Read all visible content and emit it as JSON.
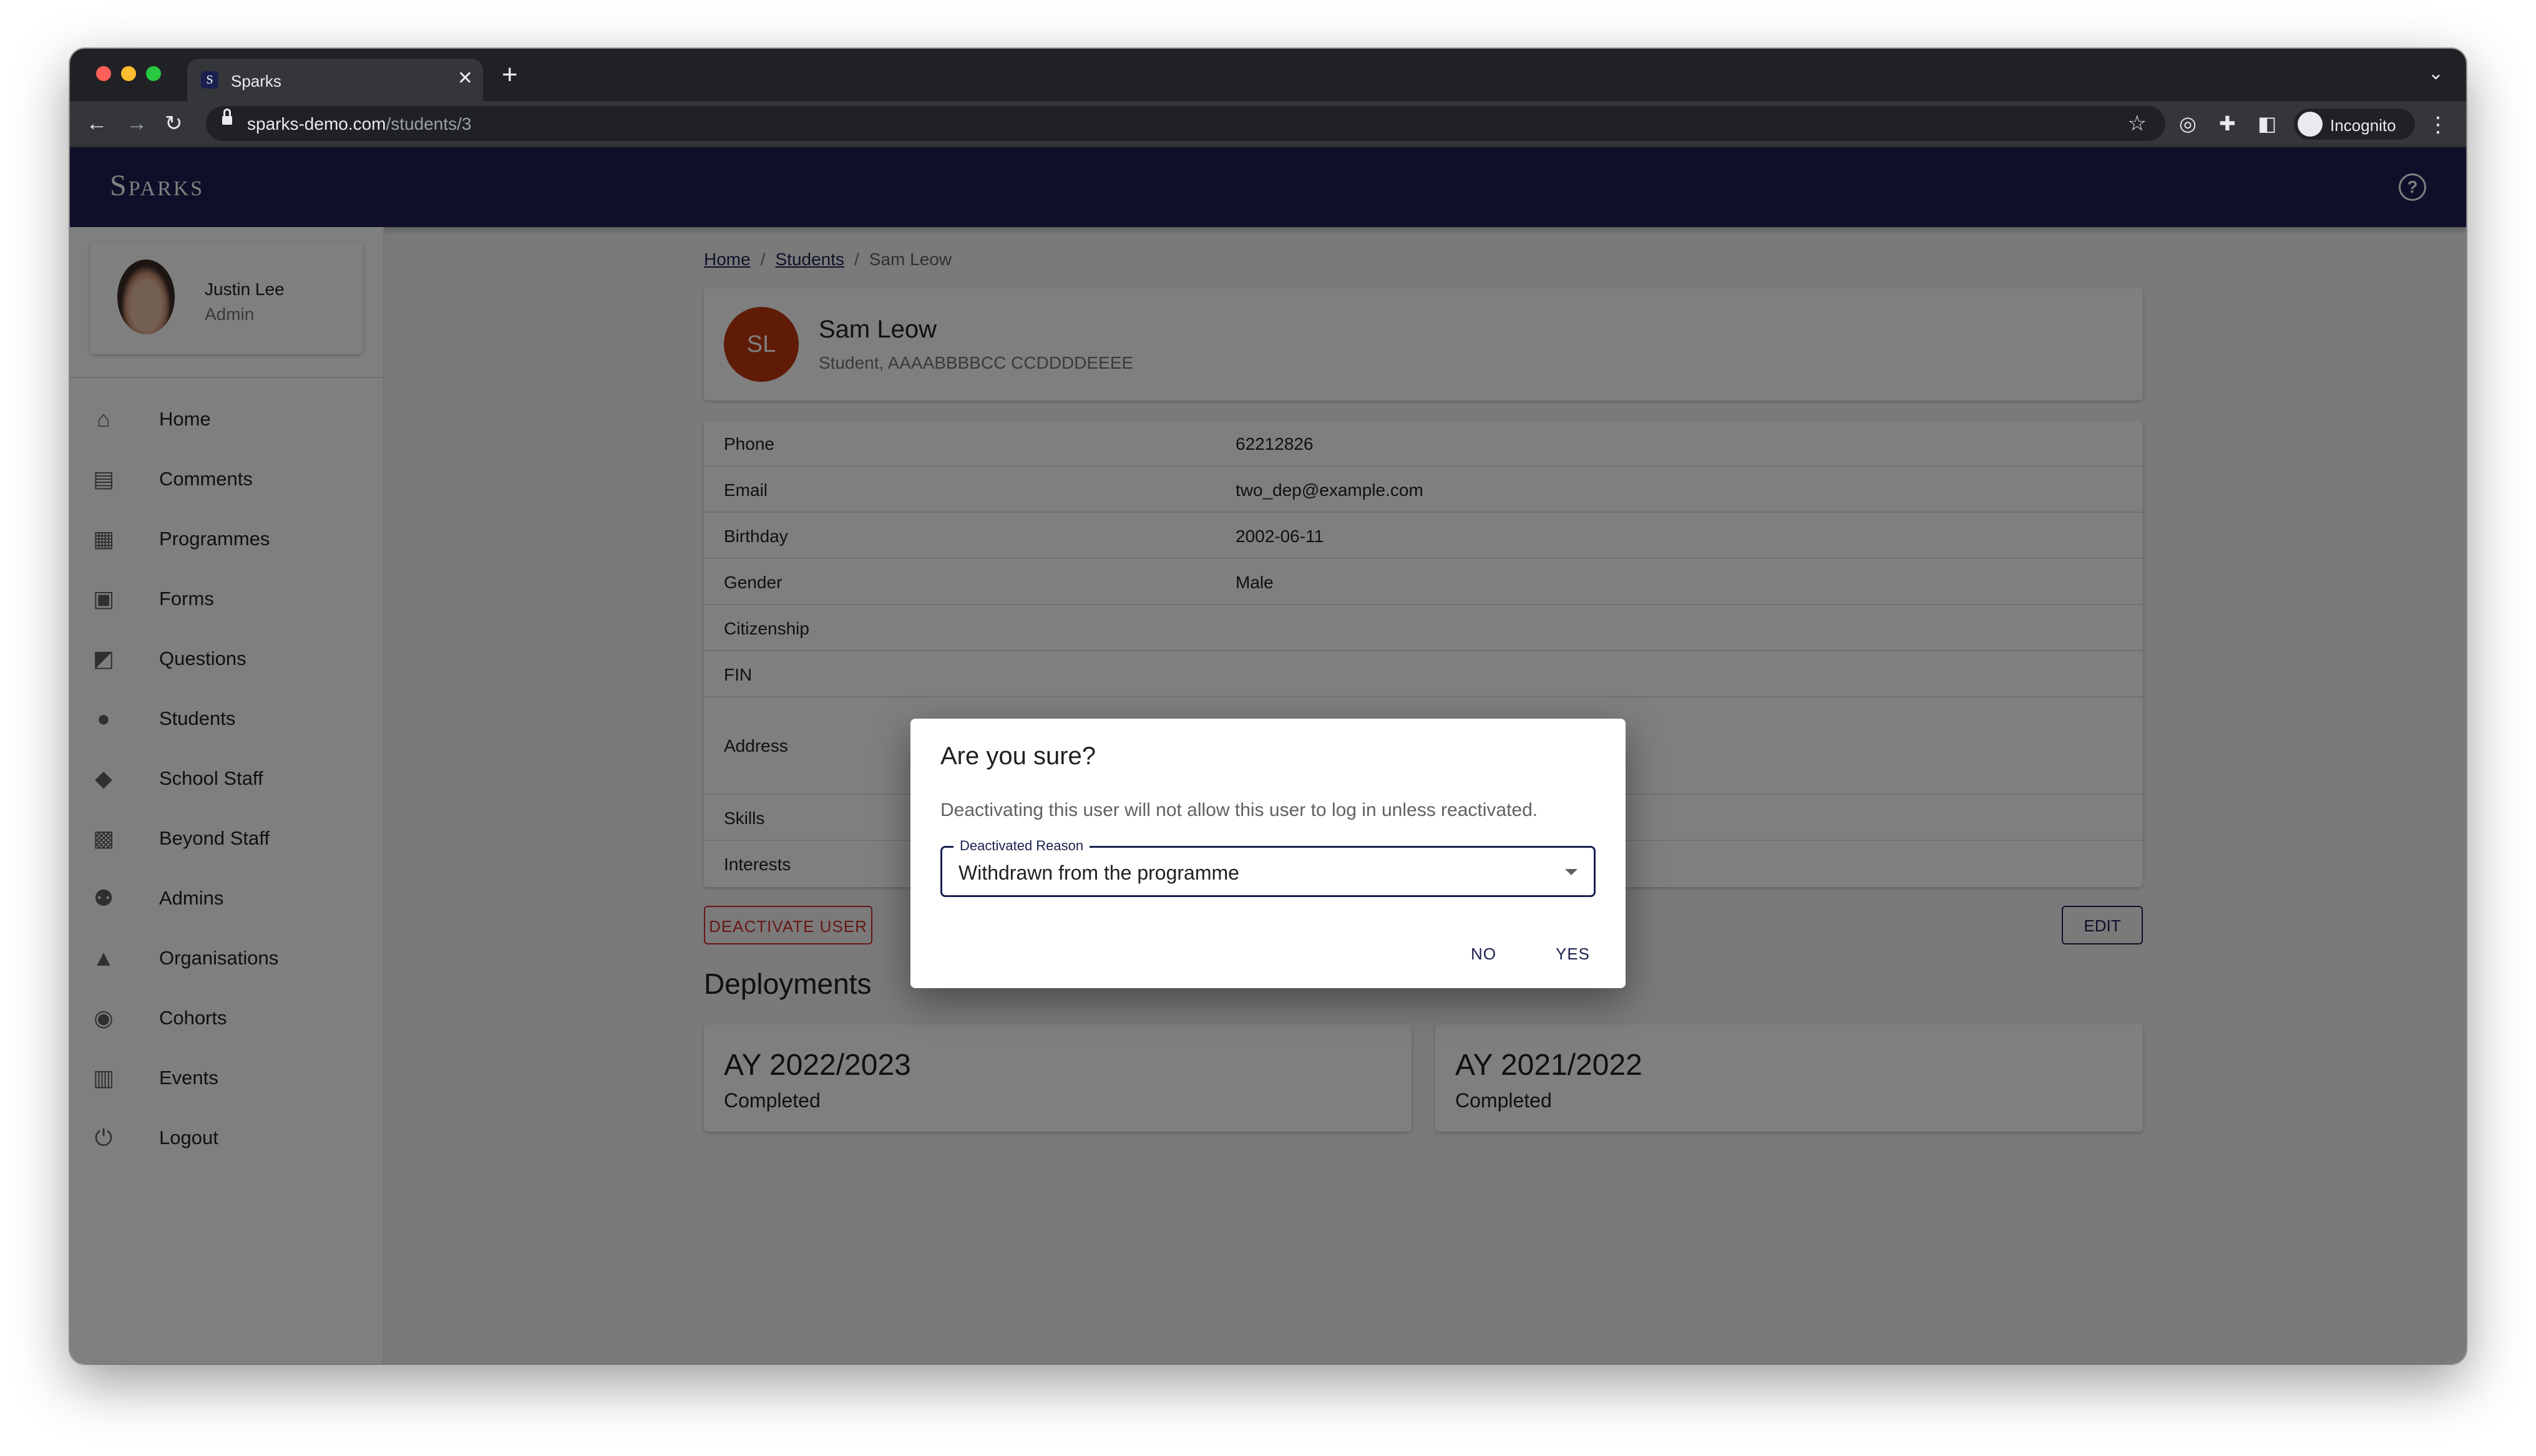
{
  "browser": {
    "tab_title": "Sparks",
    "tab_favicon": "S",
    "url_host": "sparks-demo.com",
    "url_path": "/students/3",
    "profile_label": "Incognito"
  },
  "app": {
    "brand": "Sparks"
  },
  "user": {
    "name": "Justin Lee",
    "role": "Admin"
  },
  "sidebar": {
    "items": [
      {
        "label": "Home",
        "icon": "home-icon"
      },
      {
        "label": "Comments",
        "icon": "comment-icon"
      },
      {
        "label": "Programmes",
        "icon": "document-icon"
      },
      {
        "label": "Forms",
        "icon": "clipboard-icon"
      },
      {
        "label": "Questions",
        "icon": "forum-icon"
      },
      {
        "label": "Students",
        "icon": "person-icon"
      },
      {
        "label": "School Staff",
        "icon": "book-icon"
      },
      {
        "label": "Beyond Staff",
        "icon": "badge-icon"
      },
      {
        "label": "Admins",
        "icon": "people-icon"
      },
      {
        "label": "Organisations",
        "icon": "school-icon"
      },
      {
        "label": "Cohorts",
        "icon": "group-circle-icon"
      },
      {
        "label": "Events",
        "icon": "calendar-icon"
      },
      {
        "label": "Logout",
        "icon": "power-icon"
      }
    ]
  },
  "breadcrumb": {
    "home": "Home",
    "students": "Students",
    "current": "Sam Leow",
    "separator": "/"
  },
  "student": {
    "initials": "SL",
    "name": "Sam Leow",
    "subtitle": "Student, AAAABBBBCC CCDDDDEEEE",
    "avatar_color": "#bf360c"
  },
  "details": [
    {
      "label": "Phone",
      "value": "62212826"
    },
    {
      "label": "Email",
      "value": "two_dep@example.com"
    },
    {
      "label": "Birthday",
      "value": "2002-06-11"
    },
    {
      "label": "Gender",
      "value": "Male"
    },
    {
      "label": "Citizenship",
      "value": ""
    },
    {
      "label": "FIN",
      "value": ""
    },
    {
      "label": "Address",
      "value": ""
    },
    {
      "label": "Skills",
      "value": ""
    },
    {
      "label": "Interests",
      "value": ""
    }
  ],
  "actions": {
    "deactivate": "DEACTIVATE USER",
    "edit": "EDIT"
  },
  "deployments": {
    "title": "Deployments",
    "items": [
      {
        "year": "AY 2022/2023",
        "status": "Completed"
      },
      {
        "year": "AY 2021/2022",
        "status": "Completed"
      }
    ]
  },
  "dialog": {
    "title": "Are you sure?",
    "message": "Deactivating this user will not allow this user to log in unless reactivated.",
    "select_label": "Deactivated Reason",
    "select_value": "Withdrawn from the programme",
    "no": "NO",
    "yes": "YES"
  },
  "colors": {
    "primary": "#1a2150",
    "danger": "#d32f2f",
    "chrome_dark": "#202124"
  }
}
